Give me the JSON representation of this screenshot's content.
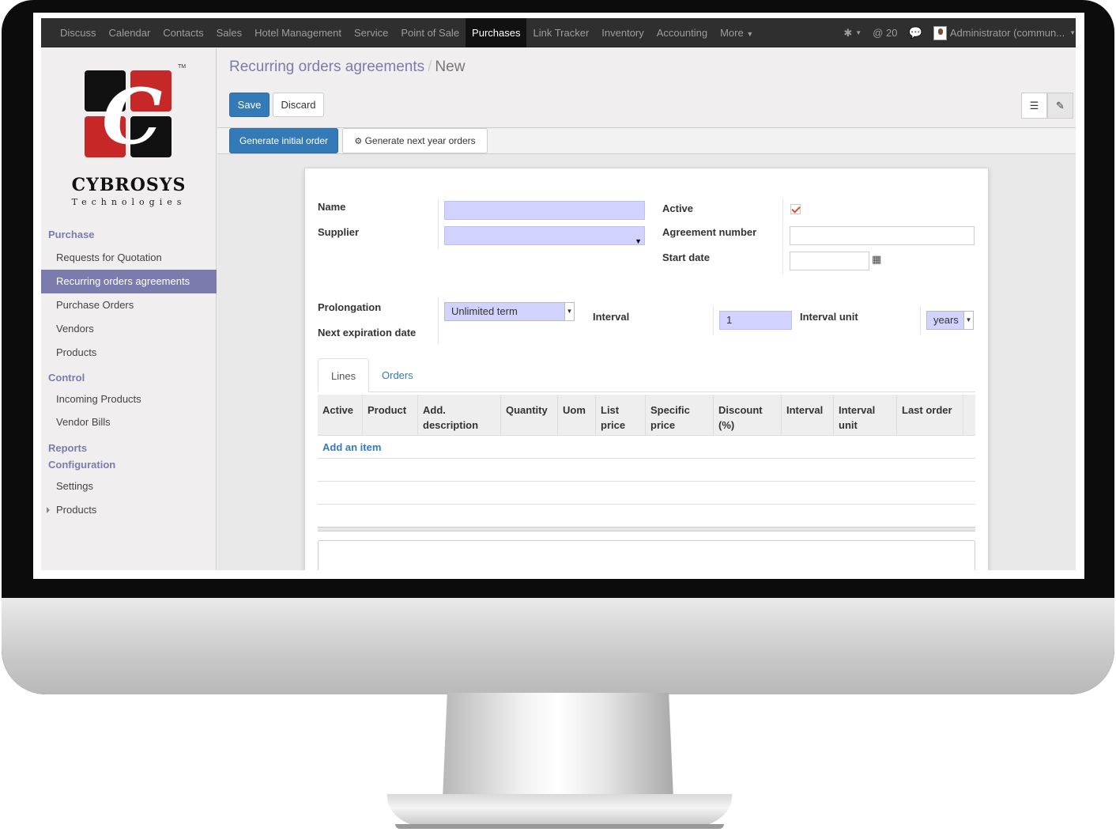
{
  "nav": {
    "menus": [
      "Discuss",
      "Calendar",
      "Contacts",
      "Sales",
      "Hotel Management",
      "Service",
      "Point of Sale",
      "Purchases",
      "Link Tracker",
      "Inventory",
      "Accounting",
      "More"
    ],
    "active_menu": "Purchases",
    "messages_count": "@ 20",
    "user": "Administrator (commun..."
  },
  "brand": {
    "name": "CYBROSYS",
    "tagline": "Technologies",
    "tm": "TM"
  },
  "sidebar": {
    "purchase_header": "Purchase",
    "purchase_items": [
      "Requests for Quotation",
      "Recurring orders agreements",
      "Purchase Orders",
      "Vendors",
      "Products"
    ],
    "control_header": "Control",
    "control_items": [
      "Incoming Products",
      "Vendor Bills"
    ],
    "reports_header": "Reports",
    "configuration_header": "Configuration",
    "configuration_items": [
      "Settings",
      "Products"
    ]
  },
  "breadcrumb": {
    "parent": "Recurring orders agreements",
    "sep": "/",
    "current": "New"
  },
  "buttons": {
    "save": "Save",
    "discard": "Discard",
    "generate_initial": "Generate initial order",
    "generate_next": "Generate next year orders"
  },
  "form": {
    "name_label": "Name",
    "supplier_label": "Supplier",
    "active_label": "Active",
    "active_checked": true,
    "agreement_number_label": "Agreement number",
    "start_date_label": "Start date",
    "prolongation_label": "Prolongation",
    "prolongation_value": "Unlimited term",
    "next_expiration_label": "Next expiration date",
    "interval_label": "Interval",
    "interval_value": "1",
    "interval_unit_label": "Interval unit",
    "interval_unit_value": "years"
  },
  "tabs": {
    "lines": "Lines",
    "orders": "Orders"
  },
  "lines_table": {
    "columns": [
      "Active",
      "Product",
      "Add. description",
      "Quantity",
      "Uom",
      "List price",
      "Specific price",
      "Discount (%)",
      "Interval",
      "Interval unit",
      "Last order"
    ],
    "add_item": "Add an item"
  },
  "colors": {
    "accent": "#7c7bad",
    "primary": "#337ab7",
    "navbar": "#2f2f2f",
    "required_bg": "#d2d2ff"
  }
}
